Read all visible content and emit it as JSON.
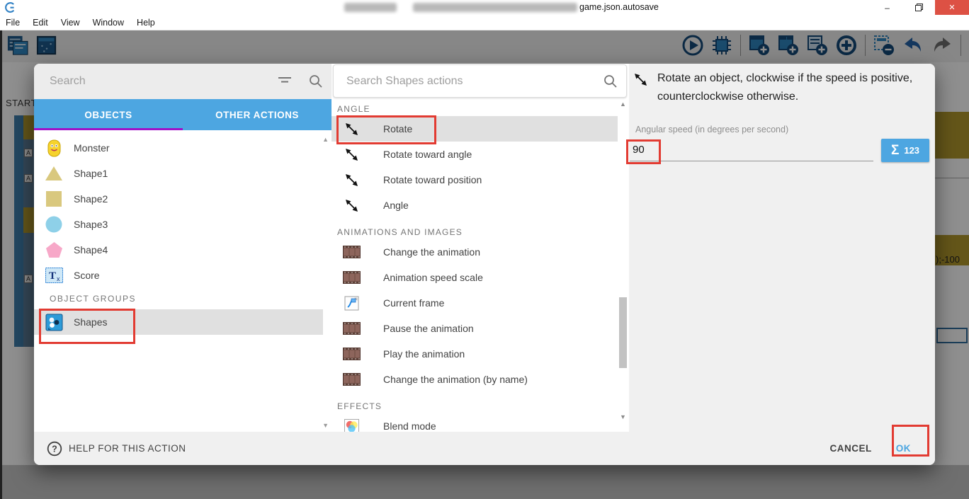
{
  "window": {
    "title": "game.json.autosave",
    "menu": [
      "File",
      "Edit",
      "View",
      "Window",
      "Help"
    ],
    "controls": {
      "minimize": "–",
      "restore": "restore",
      "close": "✕"
    }
  },
  "toolbar": {
    "left_icons": [
      "events-sheet-icon",
      "scene-editor-icon"
    ],
    "right_icons": [
      "play-icon",
      "debug-icon",
      "add-event-icon",
      "add-subevent-icon",
      "add-comment-icon",
      "add-circle-icon",
      "remove-event-icon",
      "undo-icon",
      "redo-icon",
      "search-icon"
    ]
  },
  "background": {
    "tab_label": "START",
    "code_fragment": ");-100"
  },
  "dialog": {
    "left": {
      "search_placeholder": "Search",
      "icons": [
        "filter-icon",
        "search-icon"
      ],
      "tabs": [
        {
          "label": "OBJECTS",
          "active": true
        },
        {
          "label": "OTHER ACTIONS",
          "active": false
        }
      ],
      "objects": [
        {
          "name": "Monster",
          "icon": "monster-icon"
        },
        {
          "name": "Shape1",
          "icon": "triangle-icon"
        },
        {
          "name": "Shape2",
          "icon": "square-icon"
        },
        {
          "name": "Shape3",
          "icon": "circle-icon"
        },
        {
          "name": "Shape4",
          "icon": "pentagon-icon"
        },
        {
          "name": "Score",
          "icon": "text-object-icon"
        }
      ],
      "groups_header": "OBJECT GROUPS",
      "groups": [
        {
          "name": "Shapes",
          "icon": "group-icon",
          "selected": true,
          "annotated": true
        }
      ]
    },
    "middle": {
      "search_placeholder": "Search Shapes actions",
      "sections": [
        {
          "header": "ANGLE",
          "items": [
            {
              "label": "Rotate",
              "icon": "rotate-icon",
              "selected": true,
              "annotated": true
            },
            {
              "label": "Rotate toward angle",
              "icon": "rotate-icon"
            },
            {
              "label": "Rotate toward position",
              "icon": "rotate-icon"
            },
            {
              "label": "Angle",
              "icon": "rotate-icon"
            }
          ]
        },
        {
          "header": "ANIMATIONS AND IMAGES",
          "items": [
            {
              "label": "Change the animation",
              "icon": "film-icon"
            },
            {
              "label": "Animation speed scale",
              "icon": "film-icon"
            },
            {
              "label": "Current frame",
              "icon": "frame-icon"
            },
            {
              "label": "Pause the animation",
              "icon": "film-icon"
            },
            {
              "label": "Play the animation",
              "icon": "film-icon"
            },
            {
              "label": "Change the animation (by name)",
              "icon": "film-icon"
            }
          ]
        },
        {
          "header": "EFFECTS",
          "items": [
            {
              "label": "Blend mode",
              "icon": "blend-icon"
            }
          ]
        }
      ]
    },
    "right": {
      "description": "Rotate an object, clockwise if the speed is positive, counterclockwise otherwise.",
      "description_icon": "rotate-icon",
      "field_label": "Angular speed (in degrees per second)",
      "field_value": "90",
      "expression_button": {
        "sigma": "Σ",
        "digits": "123"
      }
    },
    "footer": {
      "help_label": "HELP FOR THIS ACTION",
      "cancel_label": "CANCEL",
      "ok_label": "OK"
    }
  },
  "colors": {
    "accent": "#4da6e1",
    "purple": "#a012c8",
    "annotation": "#e23b32",
    "close_red": "#dd5144",
    "selected": "#e0e0e0"
  }
}
